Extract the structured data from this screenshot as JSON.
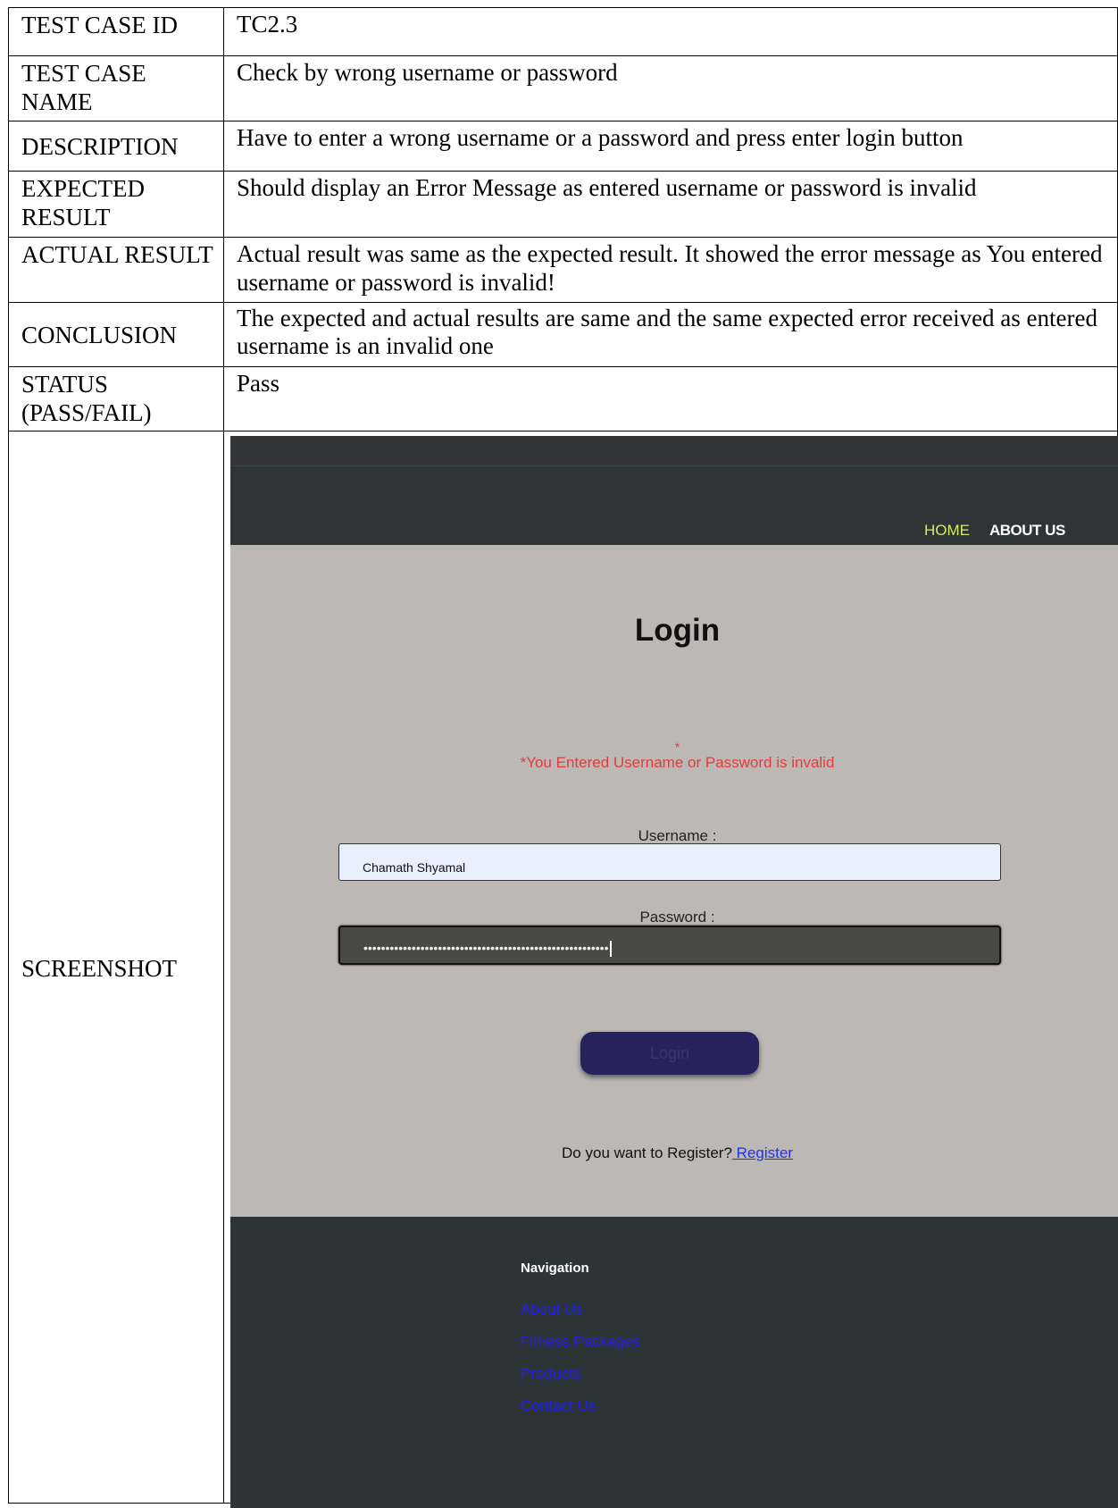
{
  "rows": [
    {
      "label": "TEST CASE ID",
      "value": "TC2.3"
    },
    {
      "label": "TEST CASE NAME",
      "value": "Check by wrong username or password"
    },
    {
      "label": "DESCRIPTION",
      "value": "Have to enter a wrong username or a password and press enter login button"
    },
    {
      "label": "EXPECTED RESULT",
      "value": "Should display an Error Message as entered username or password is invalid"
    },
    {
      "label": "ACTUAL RESULT",
      "value": "Actual result was same as the expected result. It showed the error message as You entered username or password is invalid!"
    },
    {
      "label": "CONCLUSION",
      "value": "The expected and actual results are same and the same expected error received as entered username is an invalid one"
    },
    {
      "label": "STATUS (PASS/FAIL)",
      "value": "Pass"
    },
    {
      "label": "SCREENSHOT"
    }
  ],
  "screenshot": {
    "nav": {
      "home": "HOME",
      "about": "ABOUT US"
    },
    "login_title": "Login",
    "error_star": "*",
    "error_message": "*You Entered Username or Password is invalid",
    "username_label": "Username :",
    "username_value": "Chamath Shyamal",
    "password_label": "Password :",
    "password_masked": "••••••••••••••••••••••••••••••••••••••••••••••••••••••••",
    "login_button": "Login",
    "register_prompt": "Do you want to Register?",
    "register_link": " Register",
    "footer": {
      "title": "Navigation",
      "links": [
        "About Us",
        "Fitness Packages",
        "Products",
        "Contact Us"
      ]
    },
    "colors": {
      "header_bg": "#2d3537",
      "content_bg": "#bcb8b6",
      "error": "#e23b3b",
      "active_nav": "#d7e96b",
      "button_bg": "#24235b",
      "footer_link": "#1f1ff0"
    }
  }
}
